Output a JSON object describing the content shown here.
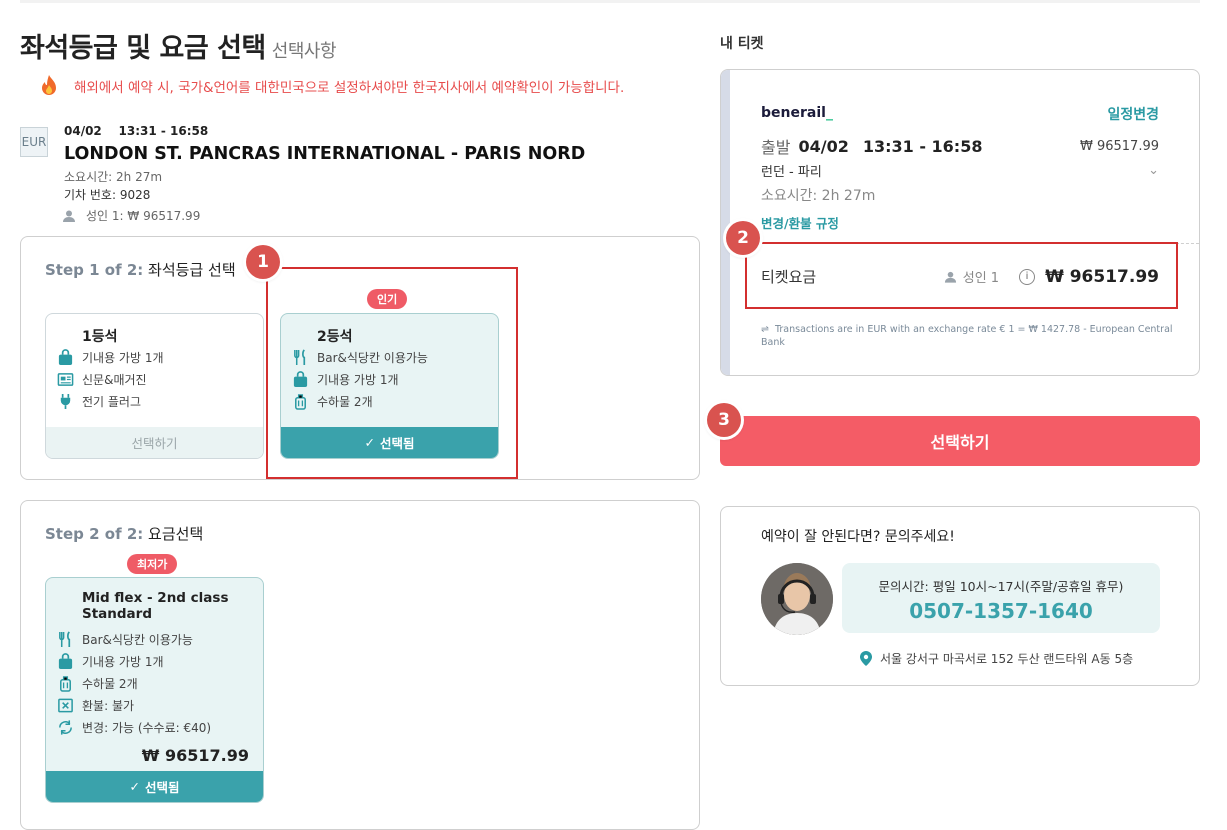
{
  "page": {
    "title": "좌석등급 및 요금 선택",
    "subtitle": "선택사항",
    "warning": "해외에서 예약 시, 국가&언어를 대한민국으로 설정하셔야만 한국지사에서 예약확인이 가능합니다."
  },
  "trip": {
    "currency_badge": "EUR",
    "date": "04/02",
    "time": "13:31 - 16:58",
    "route": "LONDON ST. PANCRAS INTERNATIONAL - PARIS NORD",
    "duration": "소요시간: 2h 27m",
    "train_no": "기차 번호: 9028",
    "passenger_price": "성인 1: ₩ 96517.99"
  },
  "step1": {
    "step_label": "Step 1 of 2:",
    "title": "좌석등급 선택",
    "cards": [
      {
        "name": "1등석",
        "features": [
          "기내용 가방 1개",
          "신문&매거진",
          "전기 플러그"
        ],
        "button": "선택하기",
        "selected": false
      },
      {
        "name": "2등석",
        "badge": "인기",
        "features": [
          "Bar&식당칸 이용가능",
          "기내용 가방 1개",
          "수하물 2개"
        ],
        "button": "선택됨",
        "selected": true
      }
    ]
  },
  "step2": {
    "step_label": "Step 2 of 2:",
    "title": "요금선택",
    "card": {
      "badge": "최저가",
      "name": "Mid flex - 2nd class Standard",
      "features": [
        "Bar&식당칸 이용가능",
        "기내용 가방 1개",
        "수하물 2개",
        "환불: 불가",
        "변경: 가능 (수수료: €40)"
      ],
      "price": "₩ 96517.99",
      "button": "선택됨"
    }
  },
  "markers": [
    "1",
    "2",
    "3"
  ],
  "ticket": {
    "section_label": "내 티켓",
    "brand": "benerail",
    "brand_suffix": "_",
    "change_link": "일정변경",
    "depart_label": "출발",
    "date": "04/02",
    "time": "13:31 - 16:58",
    "price_small": "₩ 96517.99",
    "route_kr": "런던 - 파리",
    "duration": "소요시간: 2h 27m",
    "policy_link": "변경/환불 규정",
    "fare_label": "티켓요금",
    "passenger": "성인 1",
    "total": "₩ 96517.99",
    "exchange_note": "Transactions are in EUR with an exchange rate € 1 = ₩ 1427.78 - European Central Bank"
  },
  "cta": {
    "label": "선택하기"
  },
  "contact": {
    "title": "예약이 잘 안된다면? 문의주세요!",
    "hours": "문의시간: 평일 10시~17시(주말/공휴일 휴무)",
    "phone": "0507-1357-1640",
    "address": "서울 강서구 마곡서로 152 두산 랜드타워 A동 5층"
  },
  "colors": {
    "accent": "#3aa2ab",
    "cta": "#f45c66",
    "badge": "#ef5b66",
    "marker": "#d9534f",
    "highlight": "#d32f2f"
  }
}
